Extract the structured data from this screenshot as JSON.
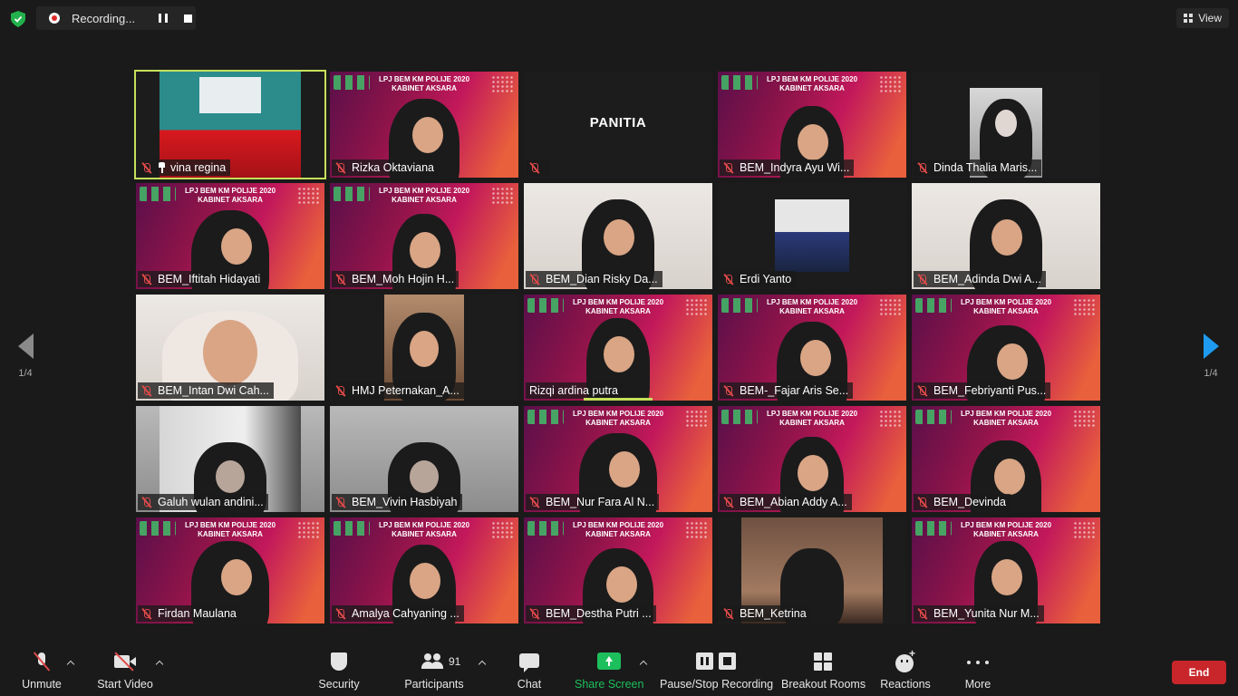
{
  "top": {
    "recording_label": "Recording...",
    "view_label": "View"
  },
  "pagination": {
    "left": "1/4",
    "right": "1/4"
  },
  "tiles": [
    {
      "name": "vina regina",
      "type": "stage",
      "active": true,
      "pinned": true
    },
    {
      "name": "Rizka Oktaviana",
      "type": "banner-dark"
    },
    {
      "name": "",
      "type": "panitia",
      "text": "PANITIA"
    },
    {
      "name": "BEM_Indyra Ayu Wi...",
      "type": "banner-face"
    },
    {
      "name": "Dinda Thalia Maris...",
      "type": "portrait"
    },
    {
      "name": "BEM_Iftitah Hidayati",
      "type": "banner"
    },
    {
      "name": "BEM_Moh Hojin H...",
      "type": "banner"
    },
    {
      "name": "BEM_Dian Risky Da...",
      "type": "room"
    },
    {
      "name": "Erdi Yanto",
      "type": "photo"
    },
    {
      "name": "BEM_Adinda Dwi A...",
      "type": "room"
    },
    {
      "name": "BEM_Intan Dwi Cah...",
      "type": "room-close"
    },
    {
      "name": "HMJ Peternakan_A...",
      "type": "portrait-dark"
    },
    {
      "name": "Rizqi ardina putra",
      "type": "banner-speaking"
    },
    {
      "name": "BEM-_Fajar Aris Se...",
      "type": "banner"
    },
    {
      "name": "BEM_Febriyanti Pus...",
      "type": "banner"
    },
    {
      "name": "Galuh wulan andini...",
      "type": "grey-portrait"
    },
    {
      "name": "BEM_Vivin Hasbiyah",
      "type": "grey"
    },
    {
      "name": "BEM_Nur Fara Al N...",
      "type": "banner"
    },
    {
      "name": "BEM_Abian Addy A...",
      "type": "banner"
    },
    {
      "name": "BEM_Devinda",
      "type": "banner"
    },
    {
      "name": "Firdan Maulana",
      "type": "banner"
    },
    {
      "name": "Amalya Cahyaning ...",
      "type": "banner"
    },
    {
      "name": "BEM_Destha Putri ...",
      "type": "banner"
    },
    {
      "name": "BEM_Ketrina",
      "type": "wall"
    },
    {
      "name": "BEM_Yunita Nur M...",
      "type": "banner"
    }
  ],
  "banner_text": "LPJ BEM KM POLIJE 2020\nKABINET AKSARA",
  "toolbar": {
    "unmute": "Unmute",
    "start_video": "Start Video",
    "security": "Security",
    "participants": "Participants",
    "participants_count": "91",
    "chat": "Chat",
    "share_screen": "Share Screen",
    "pause_stop": "Pause/Stop Recording",
    "breakout": "Breakout Rooms",
    "reactions": "Reactions",
    "more": "More",
    "end": "End"
  },
  "colors": {
    "active_speaker": "#c6e05a",
    "share_green": "#1dbf5c",
    "end_red": "#c8262b",
    "muted_red": "#e04a4a"
  }
}
